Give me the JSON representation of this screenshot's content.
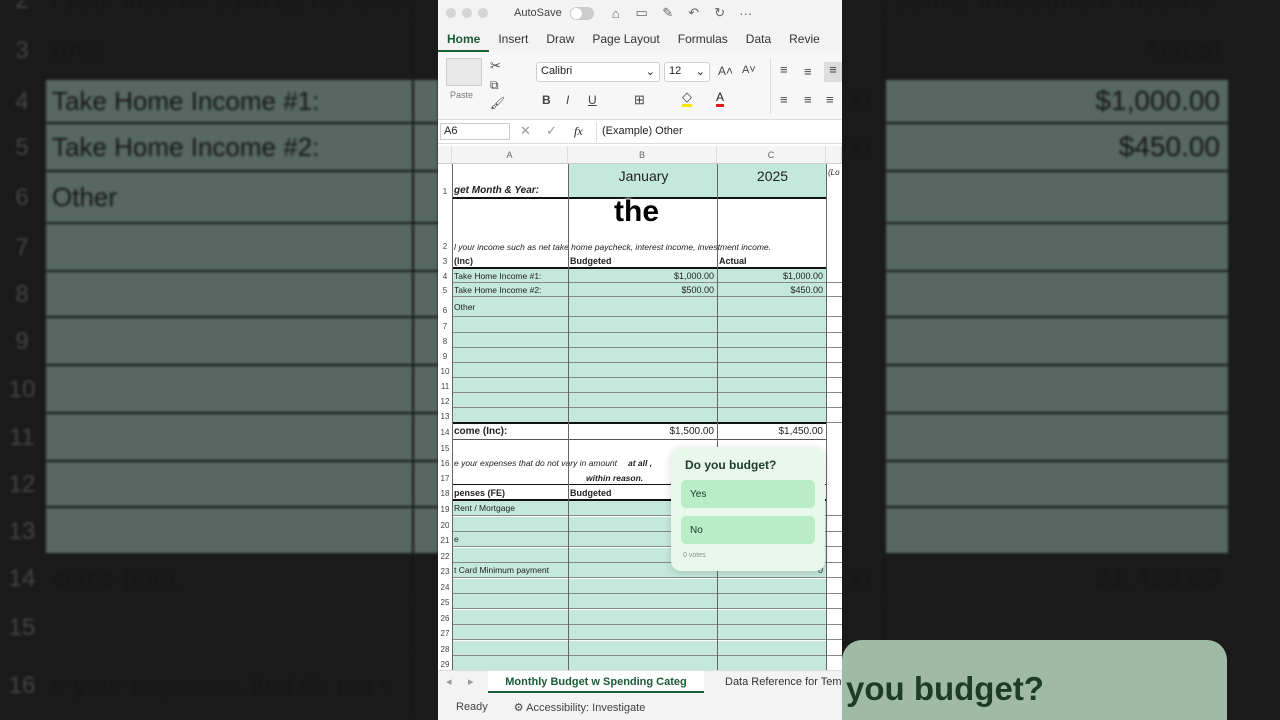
{
  "background": {
    "rows": [
      {
        "num": "2",
        "a": "l your income such as net take",
        "c": "come, investment income.",
        "mint": false
      },
      {
        "num": "3",
        "a": "(Inc)",
        "c": "Actual",
        "mint": false
      },
      {
        "num": "4",
        "a": "Take Home Income #1:",
        "c": "$1,000.00",
        "mid": "00",
        "mint": true
      },
      {
        "num": "5",
        "a": "Take Home Income #2:",
        "c": "$450.00",
        "mid": "00",
        "mint": true
      },
      {
        "num": "6",
        "a": "Other",
        "c": "",
        "mint": true
      },
      {
        "num": "7",
        "a": "",
        "c": "",
        "mint": true
      },
      {
        "num": "8",
        "a": "",
        "c": "",
        "mint": true
      },
      {
        "num": "9",
        "a": "",
        "c": "",
        "mint": true
      },
      {
        "num": "10",
        "a": "",
        "c": "",
        "mint": true
      },
      {
        "num": "11",
        "a": "",
        "c": "",
        "mint": true
      },
      {
        "num": "12",
        "a": "",
        "c": "",
        "mint": true
      },
      {
        "num": "13",
        "a": "",
        "c": "",
        "mint": true
      },
      {
        "num": "14",
        "a": "come (Inc):",
        "c": "$1,450.00",
        "mid": "00",
        "mint": false
      },
      {
        "num": "15",
        "a": "",
        "c": "",
        "mint": false
      },
      {
        "num": "16",
        "a": "e your expenses that do not v",
        "c": "",
        "mint": false
      }
    ],
    "big_question": "you budget?"
  },
  "titlebar": {
    "autosave_label": "AutoSave",
    "more": "···"
  },
  "ribbon_tabs": [
    "Home",
    "Insert",
    "Draw",
    "Page Layout",
    "Formulas",
    "Data",
    "Revie"
  ],
  "ribbon": {
    "paste_label": "Paste",
    "font_name": "Calibri",
    "font_size": "12",
    "grow_font": "A˄",
    "shrink_font": "A˅",
    "bold": "B",
    "italic": "I",
    "underline": "U",
    "font_color_letter": "A"
  },
  "formula_bar": {
    "cell_ref": "A6",
    "fx": "fx",
    "content": "(Example) Other"
  },
  "columns": [
    "A",
    "B",
    "C"
  ],
  "caption_word": "the",
  "sheet": {
    "r1": {
      "num": "1",
      "a": "get Month & Year:",
      "b": "January",
      "c": "2025",
      "d": "(Lo"
    },
    "r2": {
      "num": "2",
      "a": "l your income such as net take home paycheck, interest income, investment income."
    },
    "r3": {
      "num": "3",
      "a": "(Inc)",
      "b": "Budgeted",
      "c": "Actual"
    },
    "income_rows": [
      {
        "num": "4",
        "a": "Take Home Income #1:",
        "b": "$1,000.00",
        "c": "$1,000.00"
      },
      {
        "num": "5",
        "a": "Take Home Income #2:",
        "b": "$500.00",
        "c": "$450.00"
      },
      {
        "num": "6",
        "a": "Other",
        "b": "",
        "c": ""
      },
      {
        "num": "7",
        "a": "",
        "b": "",
        "c": ""
      },
      {
        "num": "8",
        "a": "",
        "b": "",
        "c": ""
      },
      {
        "num": "9",
        "a": "",
        "b": "",
        "c": ""
      },
      {
        "num": "10",
        "a": "",
        "b": "",
        "c": ""
      },
      {
        "num": "11",
        "a": "",
        "b": "",
        "c": ""
      },
      {
        "num": "12",
        "a": "",
        "b": "",
        "c": ""
      },
      {
        "num": "13",
        "a": "",
        "b": "",
        "c": ""
      }
    ],
    "r14": {
      "num": "14",
      "a": "come (Inc):",
      "b": "$1,500.00",
      "c": "$1,450.00"
    },
    "r15": {
      "num": "15"
    },
    "r16": {
      "num": "16",
      "a": "e your expenses that do not vary in amount",
      "a_bold": "at all ,"
    },
    "r17": {
      "num": "17",
      "b": "within reason."
    },
    "r18": {
      "num": "18",
      "a": "penses (FE)",
      "b": "Budgeted"
    },
    "expense_rows": [
      {
        "num": "19",
        "a": "Rent / Mortgage"
      },
      {
        "num": "20",
        "a": ""
      },
      {
        "num": "21",
        "a": "e"
      },
      {
        "num": "22",
        "a": ""
      },
      {
        "num": "23",
        "a": "t Card Minimum payment",
        "c": "0"
      },
      {
        "num": "24",
        "a": ""
      },
      {
        "num": "25",
        "a": ""
      },
      {
        "num": "26",
        "a": ""
      },
      {
        "num": "27",
        "a": ""
      },
      {
        "num": "28",
        "a": ""
      },
      {
        "num": "29",
        "a": ""
      }
    ]
  },
  "sheet_tabs": {
    "active": "Monthly Budget w Spending Categ",
    "other": "Data Reference for Tem"
  },
  "status": {
    "ready": "Ready",
    "accessibility": "Accessibility: Investigate"
  },
  "poll": {
    "question": "Do you budget?",
    "options": [
      "Yes",
      "No"
    ],
    "votes": "0 votes"
  }
}
